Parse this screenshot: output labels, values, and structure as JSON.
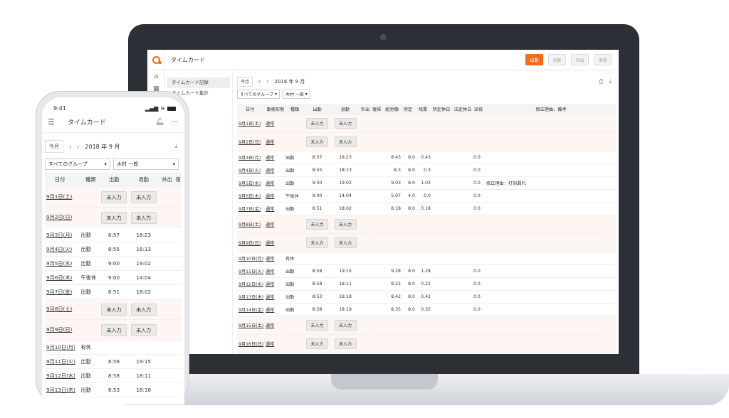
{
  "desktop": {
    "app_title": "タイムカード",
    "actions": [
      {
        "label": "出勤",
        "primary": true
      },
      {
        "label": "退勤",
        "primary": false
      },
      {
        "label": "外出",
        "primary": false
      },
      {
        "label": "復帰",
        "primary": false
      }
    ],
    "subnav": [
      "タイムカード記録",
      "タイムカード集計"
    ],
    "today_label": "今月",
    "month_label": "2018 年 9 月",
    "group_filter": "すべてのグループ",
    "person_filter": "木村 一郎",
    "headers": {
      "date": "日付",
      "type": "勤務形態",
      "kind": "種類",
      "in": "出勤",
      "out": "退勤",
      "go": "外出",
      "ret": "復帰",
      "labor": "総労働",
      "sched": "所定",
      "over": "残業",
      "phol": "所定休日",
      "lhol": "法定休日",
      "late": "深夜",
      "reason": "修正理由、備考"
    },
    "not_entered": "未入力",
    "rows": [
      {
        "date": "9月1日(土)",
        "type": "通常",
        "kind": "",
        "in": "",
        "out": "",
        "labor": "",
        "sched": "",
        "over": "",
        "late": "",
        "reason": "",
        "empty": true
      },
      {
        "date": "9月2日(日)",
        "type": "通常",
        "kind": "",
        "in": "",
        "out": "",
        "labor": "",
        "sched": "",
        "over": "",
        "late": "",
        "reason": "",
        "empty": true
      },
      {
        "date": "9月3日(月)",
        "type": "通常",
        "kind": "出勤",
        "in": "8:57",
        "out": "18:23",
        "labor": "8.43",
        "sched": "8.0",
        "over": "0.43",
        "late": "0.0",
        "reason": "",
        "empty": false
      },
      {
        "date": "9月4日(火)",
        "type": "通常",
        "kind": "出勤",
        "in": "8:55",
        "out": "18:13",
        "labor": "8.3",
        "sched": "8.0",
        "over": "0.3",
        "late": "0.0",
        "reason": "",
        "empty": false
      },
      {
        "date": "9月5日(水)",
        "type": "通常",
        "kind": "出勤",
        "in": "9:00",
        "out": "19:02",
        "labor": "9.03",
        "sched": "8.0",
        "over": "1.03",
        "late": "0.0",
        "reason": "修正理由：打刻漏れ",
        "empty": false
      },
      {
        "date": "9月6日(木)",
        "type": "通常",
        "kind": "午後休",
        "in": "9:00",
        "out": "14:04",
        "labor": "5.07",
        "sched": "4.0",
        "over": "0.0",
        "late": "0.0",
        "reason": "",
        "empty": false
      },
      {
        "date": "9月7日(金)",
        "type": "通常",
        "kind": "出勤",
        "in": "8:51",
        "out": "18:02",
        "labor": "8.18",
        "sched": "8.0",
        "over": "0.18",
        "late": "0.0",
        "reason": "",
        "empty": false
      },
      {
        "date": "9月8日(土)",
        "type": "通常",
        "kind": "",
        "in": "",
        "out": "",
        "labor": "",
        "sched": "",
        "over": "",
        "late": "",
        "reason": "",
        "empty": true
      },
      {
        "date": "9月9日(日)",
        "type": "通常",
        "kind": "",
        "in": "",
        "out": "",
        "labor": "",
        "sched": "",
        "over": "",
        "late": "",
        "reason": "",
        "empty": true
      },
      {
        "date": "9月10日(月)",
        "type": "通常",
        "kind": "有休",
        "in": "",
        "out": "",
        "labor": "",
        "sched": "",
        "over": "",
        "late": "",
        "reason": "",
        "empty": false
      },
      {
        "date": "9月11日(火)",
        "type": "通常",
        "kind": "出勤",
        "in": "8:58",
        "out": "19:15",
        "labor": "9.28",
        "sched": "8.0",
        "over": "1.28",
        "late": "0.0",
        "reason": "",
        "empty": false
      },
      {
        "date": "9月12日(水)",
        "type": "通常",
        "kind": "出勤",
        "in": "8:58",
        "out": "18:11",
        "labor": "8.22",
        "sched": "8.0",
        "over": "0.22",
        "late": "0.0",
        "reason": "",
        "empty": false
      },
      {
        "date": "9月13日(木)",
        "type": "通常",
        "kind": "出勤",
        "in": "8:53",
        "out": "18:18",
        "labor": "8.42",
        "sched": "8.0",
        "over": "0.42",
        "late": "0.0",
        "reason": "",
        "empty": false
      },
      {
        "date": "9月14日(金)",
        "type": "通常",
        "kind": "出勤",
        "in": "8:58",
        "out": "18:19",
        "labor": "8.35",
        "sched": "8.0",
        "over": "0.35",
        "late": "0.0",
        "reason": "",
        "empty": false
      },
      {
        "date": "9月15日(土)",
        "type": "通常",
        "kind": "",
        "in": "",
        "out": "",
        "labor": "",
        "sched": "",
        "over": "",
        "late": "",
        "reason": "",
        "empty": true
      },
      {
        "date": "9月16日(日)",
        "type": "通常",
        "kind": "",
        "in": "",
        "out": "",
        "labor": "",
        "sched": "",
        "over": "",
        "late": "",
        "reason": "",
        "empty": true
      }
    ]
  },
  "mobile": {
    "time": "9:41",
    "title": "タイムカード",
    "today_label": "今月",
    "month_label": "2018 年 9 月",
    "group_filter": "すべてのグループ",
    "person_filter": "木村 一郎",
    "headers": {
      "date": "日付",
      "kind": "種類",
      "in": "出勤",
      "out": "退勤",
      "go": "外出",
      "ret": "復"
    },
    "not_entered": "未入力",
    "rows": [
      {
        "date": "9月1日(土)",
        "kind": "",
        "in": "",
        "out": "",
        "empty": true
      },
      {
        "date": "9月2日(日)",
        "kind": "",
        "in": "",
        "out": "",
        "empty": true
      },
      {
        "date": "9月3日(月)",
        "kind": "出勤",
        "in": "8:57",
        "out": "18:23",
        "empty": false
      },
      {
        "date": "9月4日(火)",
        "kind": "出勤",
        "in": "8:55",
        "out": "18:13",
        "empty": false
      },
      {
        "date": "9月5日(水)",
        "kind": "出勤",
        "in": "9:00",
        "out": "19:02",
        "empty": false
      },
      {
        "date": "9月6日(木)",
        "kind": "午後休",
        "in": "9:00",
        "out": "14:04",
        "empty": false
      },
      {
        "date": "9月7日(金)",
        "kind": "出勤",
        "in": "8:51",
        "out": "18:02",
        "empty": false
      },
      {
        "date": "9月8日(土)",
        "kind": "",
        "in": "",
        "out": "",
        "empty": true
      },
      {
        "date": "9月9日(日)",
        "kind": "",
        "in": "",
        "out": "",
        "empty": true
      },
      {
        "date": "9月10日(月)",
        "kind": "有休",
        "in": "",
        "out": "",
        "empty": false
      },
      {
        "date": "9月11日(火)",
        "kind": "出勤",
        "in": "8:58",
        "out": "19:15",
        "empty": false
      },
      {
        "date": "9月12日(水)",
        "kind": "出勤",
        "in": "8:58",
        "out": "18:11",
        "empty": false
      },
      {
        "date": "9月13日(木)",
        "kind": "出勤",
        "in": "8:53",
        "out": "18:18",
        "empty": false
      }
    ]
  }
}
